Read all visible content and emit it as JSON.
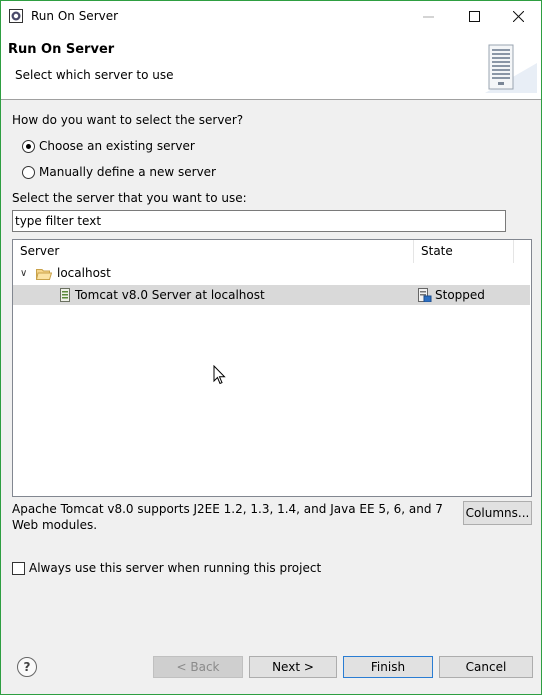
{
  "window": {
    "title": "Run On Server"
  },
  "header": {
    "title": "Run On Server",
    "subtitle": "Select which server to use"
  },
  "selection": {
    "question": "How do you want to select the server?",
    "options": [
      {
        "label": "Choose an existing server",
        "selected": true
      },
      {
        "label": "Manually define a new server",
        "selected": false
      }
    ]
  },
  "filter": {
    "label": "Select the server that you want to use:",
    "value": "type filter text"
  },
  "table": {
    "columns": [
      "Server",
      "State"
    ],
    "group": {
      "label": "localhost",
      "expanded": true
    },
    "rows": [
      {
        "server": "Tomcat v8.0 Server at localhost",
        "state": "Stopped",
        "selected": true
      }
    ]
  },
  "description": "Apache Tomcat v8.0 supports J2EE 1.2, 1.3, 1.4, and Java EE 5, 6, and 7 Web modules.",
  "columns_button": "Columns...",
  "always_checkbox": {
    "label": "Always use this server when running this project",
    "checked": false
  },
  "footer": {
    "back": "< Back",
    "next": "Next >",
    "finish": "Finish",
    "cancel": "Cancel",
    "help_glyph": "?"
  },
  "colors": {
    "window_border": "#2e9e41",
    "selection_row": "#d9d9d9",
    "default_button_border": "#2a7dd3"
  }
}
